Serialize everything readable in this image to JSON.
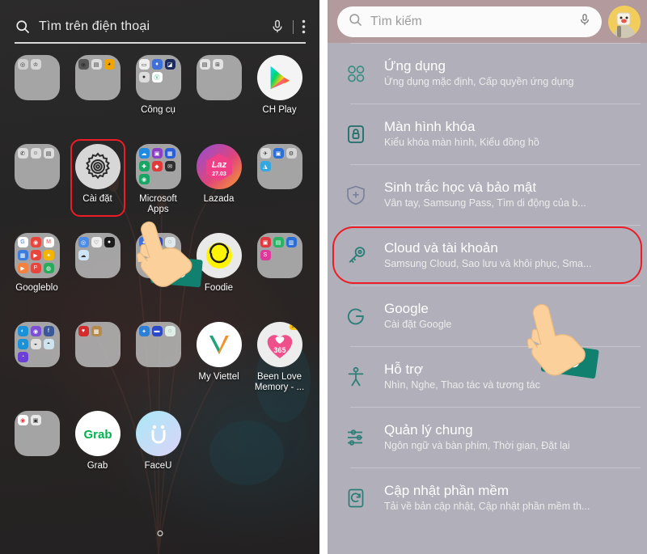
{
  "home": {
    "search": {
      "placeholder": "Tìm trên điện thoại",
      "search_icon": "search-icon",
      "mic_icon": "microphone-icon",
      "menu_icon": "more-vertical-icon"
    },
    "rows": [
      [
        {
          "type": "folder",
          "label": "",
          "minis": [
            "◎",
            "♔"
          ]
        },
        {
          "type": "folder",
          "label": "",
          "minis": [
            "◉",
            "▤",
            "◕"
          ]
        },
        {
          "type": "folder",
          "label": "Công cụ",
          "minis": [
            "▭",
            "♦",
            "◪",
            "●",
            "Ⓥ"
          ]
        },
        {
          "type": "folder",
          "label": "",
          "minis": [
            "▤",
            "⊞"
          ]
        },
        {
          "type": "app",
          "label": "CH Play",
          "icon": "play-store-icon"
        }
      ],
      [
        {
          "type": "folder",
          "label": "",
          "minis": [
            "✆",
            "☺",
            "▤"
          ]
        },
        {
          "type": "app",
          "label": "Cài đặt",
          "icon": "gear-icon",
          "highlighted": true
        },
        {
          "type": "folder",
          "label": "Microsoft Apps",
          "minis": [
            "☁",
            "▣",
            "▦",
            "✚",
            "◆",
            "✉",
            "◉"
          ]
        },
        {
          "type": "app",
          "label": "Lazada",
          "icon": "lazada-icon"
        },
        {
          "type": "folder",
          "label": "",
          "minis": [
            "✈",
            "▣",
            "⚙",
            "◮"
          ]
        }
      ],
      [
        {
          "type": "folder",
          "label": "Googleblo",
          "minis": [
            "G",
            "◉",
            "M",
            "▦",
            "▶",
            "✦",
            "▶",
            "P",
            "◍"
          ]
        },
        {
          "type": "folder",
          "label": "",
          "minis": [
            "◎",
            "♡",
            "●",
            "☁"
          ]
        },
        {
          "type": "folder",
          "label": "",
          "minis": [
            "◍",
            "◉",
            "◆"
          ]
        },
        {
          "type": "app",
          "label": "Foodie",
          "icon": "foodie-icon"
        },
        {
          "type": "folder",
          "label": "",
          "minis": [
            "▣",
            "▤",
            "▥",
            "S"
          ]
        }
      ],
      [
        {
          "type": "folder",
          "label": "",
          "minis": [
            "◐",
            "◉",
            "f",
            "◑",
            "◒",
            "◓",
            "◔"
          ]
        },
        {
          "type": "folder",
          "label": "",
          "minis": [
            "♥",
            "▩"
          ]
        },
        {
          "type": "folder",
          "label": "",
          "minis": [
            "✦",
            "▬",
            "◌"
          ]
        },
        {
          "type": "app",
          "label": "My Viettel",
          "icon": "viettel-icon"
        },
        {
          "type": "app",
          "label": "Been Love Memory - ...",
          "icon": "been-love-memory-icon",
          "badge": "365"
        }
      ],
      [
        {
          "type": "folder",
          "label": "",
          "minis": [
            "◉",
            "▣"
          ]
        },
        {
          "type": "app",
          "label": "Grab",
          "icon": "grab-icon"
        },
        {
          "type": "app",
          "label": "FaceU",
          "icon": "faceu-icon"
        }
      ]
    ],
    "page_indicator": "page-dot"
  },
  "settings": {
    "search": {
      "placeholder": "Tìm kiếm",
      "search_icon": "search-icon",
      "mic_icon": "microphone-icon"
    },
    "avatar": "user-avatar",
    "items": [
      {
        "title": "Ứng dụng",
        "subtitle": "Ứng dụng mặc định, Cấp quyền ứng dụng",
        "icon": "apps-grid-icon",
        "highlighted": false
      },
      {
        "title": "Màn hình khóa",
        "subtitle": "Kiểu khóa màn hình, Kiểu đồng hồ",
        "icon": "lock-icon",
        "highlighted": false
      },
      {
        "title": "Sinh trắc học và bảo mật",
        "subtitle": "Vân tay, Samsung Pass, Tìm di động của b...",
        "icon": "shield-plus-icon",
        "highlighted": false
      },
      {
        "title": "Cloud và tài khoản",
        "subtitle": "Samsung Cloud, Sao lưu và khôi phục, Sma...",
        "icon": "key-icon",
        "highlighted": true
      },
      {
        "title": "Google",
        "subtitle": "Cài đặt Google",
        "icon": "google-g-icon",
        "highlighted": false
      },
      {
        "title": "Hỗ trợ",
        "subtitle": "Nhìn, Nghe, Thao tác và tương tác",
        "icon": "accessibility-icon",
        "highlighted": false
      },
      {
        "title": "Quản lý chung",
        "subtitle": "Ngôn ngữ và bàn phím, Thời gian, Đặt lại",
        "icon": "sliders-icon",
        "highlighted": false
      },
      {
        "title": "Cập nhật phần mềm",
        "subtitle": "Tải về bản cập nhật, Cập nhật phần mềm th...",
        "icon": "software-update-icon",
        "highlighted": false
      }
    ]
  },
  "annotations": {
    "highlight_color": "#ee1c24",
    "accent_teal": "#2f7d74",
    "pointer_icon": "hand-pointer-cursor"
  }
}
